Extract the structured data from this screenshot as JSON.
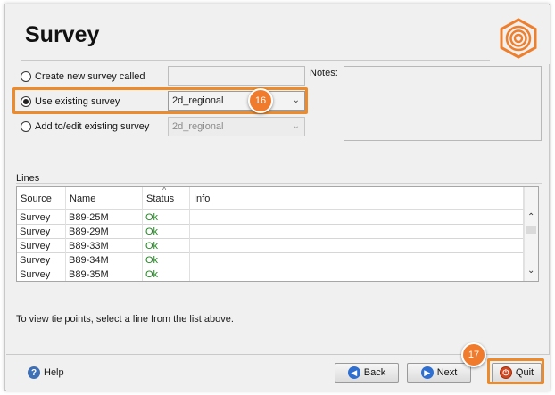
{
  "header": {
    "title": "Survey"
  },
  "survey_options": {
    "create_label": "Create new survey called",
    "use_existing_label": "Use existing survey",
    "add_edit_label": "Add to/edit existing survey",
    "use_existing_value": "2d_regional",
    "add_edit_value": "2d_regional",
    "selected": "use_existing"
  },
  "notes": {
    "label": "Notes:"
  },
  "callouts": {
    "first": "16",
    "second": "17"
  },
  "lines": {
    "label": "Lines",
    "columns": [
      "Source",
      "Name",
      "Status",
      "Info"
    ],
    "rows": [
      {
        "source": "Survey",
        "name": "B89-25M",
        "status": "Ok",
        "info": ""
      },
      {
        "source": "Survey",
        "name": "B89-29M",
        "status": "Ok",
        "info": ""
      },
      {
        "source": "Survey",
        "name": "B89-33M",
        "status": "Ok",
        "info": ""
      },
      {
        "source": "Survey",
        "name": "B89-34M",
        "status": "Ok",
        "info": ""
      },
      {
        "source": "Survey",
        "name": "B89-35M",
        "status": "Ok",
        "info": ""
      }
    ]
  },
  "instructions": "To view tie points, select a line from the list above.",
  "footer": {
    "help_label": "Help",
    "back_label": "Back",
    "next_label": "Next",
    "quit_label": "Quit"
  },
  "colors": {
    "accent": "#ed8b2c",
    "status_ok": "#1f8a1f",
    "logo": "#ee7f2d"
  },
  "icons": {
    "logo": "hexagon-rings-logo",
    "help": "help-icon",
    "back": "back-arrow-icon",
    "next": "next-arrow-icon",
    "quit": "quit-icon"
  }
}
